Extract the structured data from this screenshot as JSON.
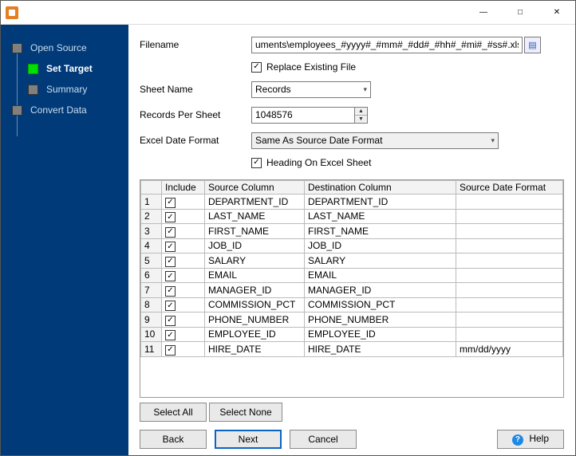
{
  "window": {
    "title": ""
  },
  "sidebar": {
    "items": [
      {
        "label": "Open Source",
        "active": false,
        "child": false
      },
      {
        "label": "Set Target",
        "active": true,
        "child": true
      },
      {
        "label": "Summary",
        "active": false,
        "child": true
      },
      {
        "label": "Convert Data",
        "active": false,
        "child": false
      }
    ]
  },
  "form": {
    "filename_label": "Filename",
    "filename_value": "uments\\employees_#yyyy#_#mm#_#dd#_#hh#_#mi#_#ss#.xlsx",
    "replace_label": "Replace Existing File",
    "replace_checked": true,
    "sheetname_label": "Sheet Name",
    "sheetname_value": "Records",
    "records_label": "Records Per Sheet",
    "records_value": "1048576",
    "dateformat_label": "Excel Date Format",
    "dateformat_value": "Same As Source Date Format",
    "heading_label": "Heading On Excel Sheet",
    "heading_checked": true
  },
  "grid": {
    "headers": {
      "num": "",
      "include": "Include",
      "source": "Source Column",
      "dest": "Destination Column",
      "srcfmt": "Source Date Format"
    },
    "rows": [
      {
        "n": "1",
        "inc": true,
        "src": "DEPARTMENT_ID",
        "dst": "DEPARTMENT_ID",
        "fmt": ""
      },
      {
        "n": "2",
        "inc": true,
        "src": "LAST_NAME",
        "dst": "LAST_NAME",
        "fmt": ""
      },
      {
        "n": "3",
        "inc": true,
        "src": "FIRST_NAME",
        "dst": "FIRST_NAME",
        "fmt": ""
      },
      {
        "n": "4",
        "inc": true,
        "src": "JOB_ID",
        "dst": "JOB_ID",
        "fmt": ""
      },
      {
        "n": "5",
        "inc": true,
        "src": "SALARY",
        "dst": "SALARY",
        "fmt": ""
      },
      {
        "n": "6",
        "inc": true,
        "src": "EMAIL",
        "dst": "EMAIL",
        "fmt": ""
      },
      {
        "n": "7",
        "inc": true,
        "src": "MANAGER_ID",
        "dst": "MANAGER_ID",
        "fmt": ""
      },
      {
        "n": "8",
        "inc": true,
        "src": "COMMISSION_PCT",
        "dst": "COMMISSION_PCT",
        "fmt": ""
      },
      {
        "n": "9",
        "inc": true,
        "src": "PHONE_NUMBER",
        "dst": "PHONE_NUMBER",
        "fmt": ""
      },
      {
        "n": "10",
        "inc": true,
        "src": "EMPLOYEE_ID",
        "dst": "EMPLOYEE_ID",
        "fmt": ""
      },
      {
        "n": "11",
        "inc": true,
        "src": "HIRE_DATE",
        "dst": "HIRE_DATE",
        "fmt": "mm/dd/yyyy"
      }
    ]
  },
  "buttons": {
    "select_all": "Select All",
    "select_none": "Select None",
    "back": "Back",
    "next": "Next",
    "cancel": "Cancel",
    "help": "Help"
  }
}
